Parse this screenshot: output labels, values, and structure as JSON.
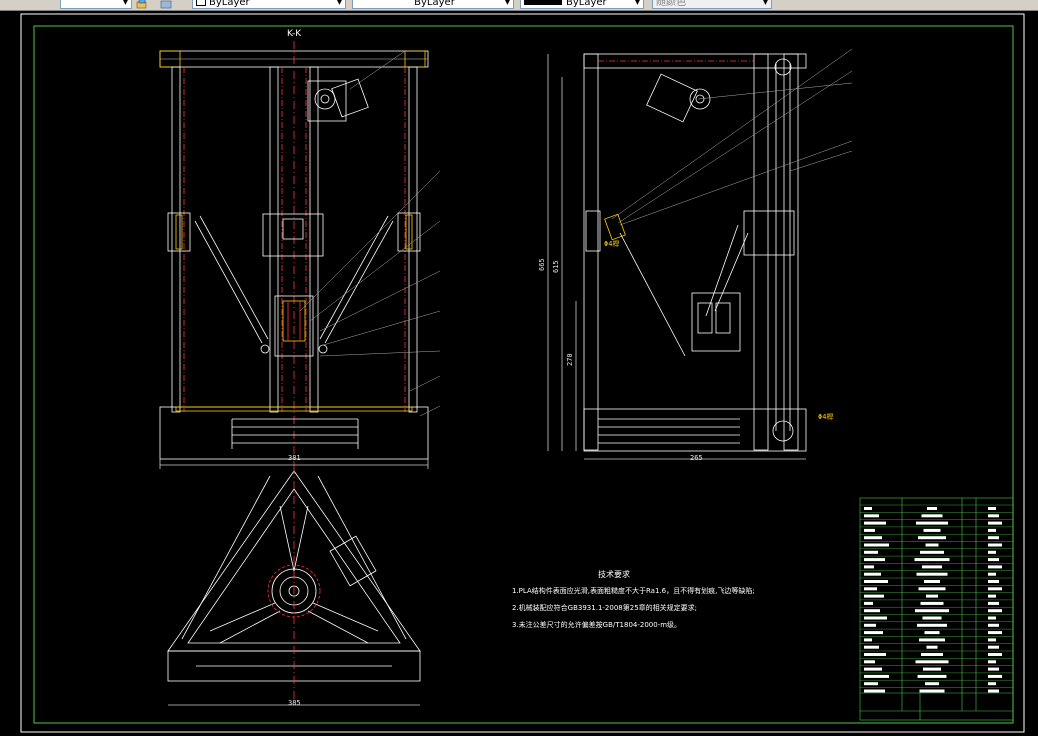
{
  "toolbar": {
    "layer_combo": "ByLayer",
    "linetype_combo": "ByLayer",
    "lineweight_combo": "ByLayer",
    "plotstyle_combo": "随颜色"
  },
  "drawing": {
    "section_label": "K-K",
    "dimensions": {
      "front_width": "381",
      "side_width": "265",
      "side_height_total": "665",
      "side_height_mid": "615",
      "side_height_lower": "270",
      "bottom_width": "385",
      "side_note_1": "Φ4桿",
      "side_note_2": "Φ4桿"
    },
    "tech_notes": {
      "title": "技术要求",
      "line1": "1.PLA结构件表面应光滑,表面粗糙度不大于Ra1.6，且不得有划痕,飞边等缺陷;",
      "line2": "2.机械装配应符合GB3931.1-2008第25章的相关规定要求;",
      "line3": "3.未注公差尺寸的允许偏差按GB/T1804-2000-m级。"
    }
  }
}
